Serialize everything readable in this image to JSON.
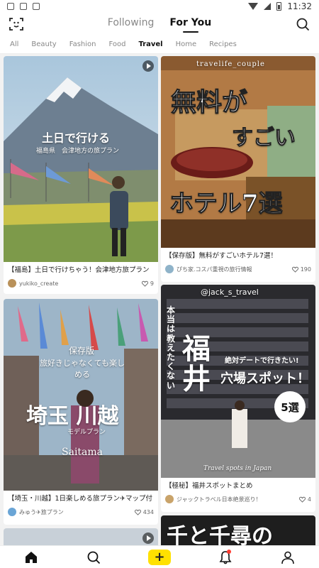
{
  "status_bar": {
    "time": "11:32"
  },
  "header": {
    "tabs": [
      {
        "label": "Following",
        "active": false
      },
      {
        "label": "For You",
        "active": true
      }
    ]
  },
  "categories": [
    {
      "label": "All",
      "active": false
    },
    {
      "label": "Beauty",
      "active": false
    },
    {
      "label": "Fashion",
      "active": false
    },
    {
      "label": "Food",
      "active": false
    },
    {
      "label": "Travel",
      "active": true
    },
    {
      "label": "Home",
      "active": false
    },
    {
      "label": "Recipes",
      "active": false
    }
  ],
  "posts": [
    {
      "overlay_line1": "土日で行ける",
      "overlay_line2": "福島県　会津地方の旅プラン",
      "title": "【福島】土日で行けちゃう！会津地方旅プラン",
      "author": "yukiko_create",
      "likes": "9"
    },
    {
      "overlay_top": "travelife_couple",
      "overlay_big1": "無料が",
      "overlay_big2": "すごい",
      "overlay_big3": "ホテル7選",
      "title": "【保存版】無料がすごいホテル7選！",
      "author": "ぴち家.コスパ重視の旅行情報",
      "likes": "190"
    },
    {
      "overlay_line1": "保存版",
      "overlay_line2": "旅好きじゃなくても楽しめる",
      "overlay_big": "埼玉 川越",
      "overlay_sub": "モデルプラン",
      "overlay_en": "Saitama",
      "title": "【埼玉・川越】1日楽しめる旅プラン✈マップ付",
      "author": "みゅう✈旅プラン",
      "likes": "434"
    },
    {
      "overlay_top": "@jack_s_travel",
      "overlay_side": "本当は教えたくない",
      "overlay_big": "福井",
      "overlay_mid1": "絶対デートで行きたい!",
      "overlay_mid2": "穴場スポット！",
      "overlay_badge": "5選",
      "overlay_foot": "Travel spots in Japan",
      "title": "【極秘】福井スポットまとめ",
      "author": "ジャックトラベル日本絶景巡り！",
      "likes": "4"
    },
    {
      "overlay_big": "千と千尋の"
    }
  ],
  "colors": {
    "accent_yellow": "#ffe100",
    "notification_red": "#ff3b30"
  }
}
